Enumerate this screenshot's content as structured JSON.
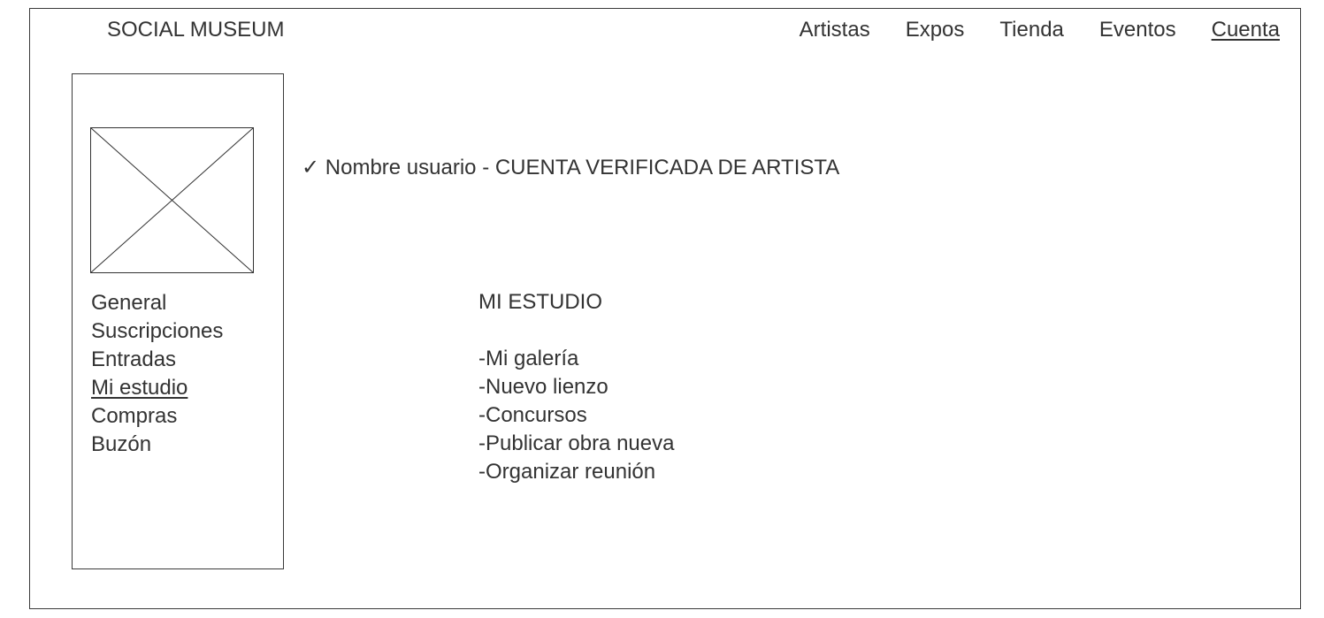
{
  "header": {
    "brand": "SOCIAL MUSEUM",
    "nav": [
      {
        "label": "Artistas"
      },
      {
        "label": "Expos"
      },
      {
        "label": "Tienda"
      },
      {
        "label": "Eventos"
      },
      {
        "label": "Cuenta",
        "active": true
      }
    ]
  },
  "sidebar": {
    "avatar_icon": "image-placeholder-icon",
    "items": [
      {
        "label": "General"
      },
      {
        "label": "Suscripciones"
      },
      {
        "label": "Entradas"
      },
      {
        "label": "Mi estudio",
        "active": true
      },
      {
        "label": "Compras"
      },
      {
        "label": "Buzón"
      }
    ]
  },
  "main": {
    "check_icon": "✓",
    "user_line": "Nombre usuario - CUENTA VERIFICADA DE ARTISTA",
    "section_title": "MI ESTUDIO",
    "options": [
      "-Mi galería",
      "-Nuevo lienzo",
      "-Concursos",
      "-Publicar obra nueva",
      "-Organizar reunión"
    ]
  }
}
